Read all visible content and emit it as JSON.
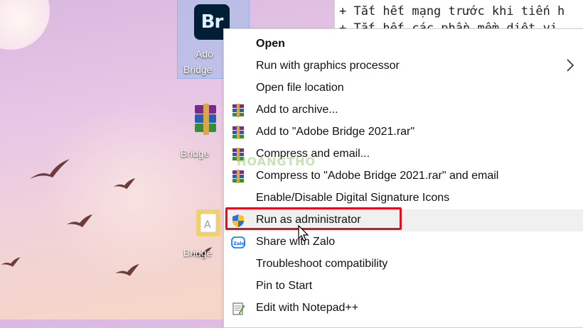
{
  "desktop": {
    "icons": [
      {
        "label": "Ado",
        "label2": "Bridge",
        "type": "adobe-bridge",
        "badge": "Br"
      },
      {
        "label": "Bridge",
        "type": "winrar"
      },
      {
        "label": "Bridge",
        "type": "folder"
      }
    ]
  },
  "editor": {
    "lines": [
      "+ Tắt hết mạng trước khi tiến h",
      "+ Tắt hết các phần mềm diệt vi"
    ]
  },
  "context_menu": {
    "items": [
      {
        "label": "Open",
        "bold": true,
        "icon": ""
      },
      {
        "label": "Run with graphics processor",
        "submenu": true,
        "icon": ""
      },
      {
        "label": "Open file location",
        "icon": ""
      },
      {
        "label": "Add to archive...",
        "icon": "winrar-icon"
      },
      {
        "label": "Add to \"Adobe Bridge 2021.rar\"",
        "icon": "winrar-icon"
      },
      {
        "label": "Compress and email...",
        "icon": "winrar-icon"
      },
      {
        "label": "Compress to \"Adobe Bridge 2021.rar\" and email",
        "icon": "winrar-icon"
      },
      {
        "label": "Enable/Disable Digital Signature Icons",
        "icon": ""
      },
      {
        "label": "Run as administrator",
        "icon": "uac-shield-icon",
        "highlighted": true
      },
      {
        "label": "Share with Zalo",
        "icon": "zalo-icon"
      },
      {
        "label": "Troubleshoot compatibility",
        "icon": ""
      },
      {
        "label": "Pin to Start",
        "icon": ""
      },
      {
        "label": "Edit with Notepad++",
        "icon": "notepad-plus-plus-icon"
      }
    ]
  },
  "watermark": "HOANGTHO",
  "colors": {
    "highlight_border": "#e0101e",
    "bridge_icon_bg": "#001e36"
  }
}
